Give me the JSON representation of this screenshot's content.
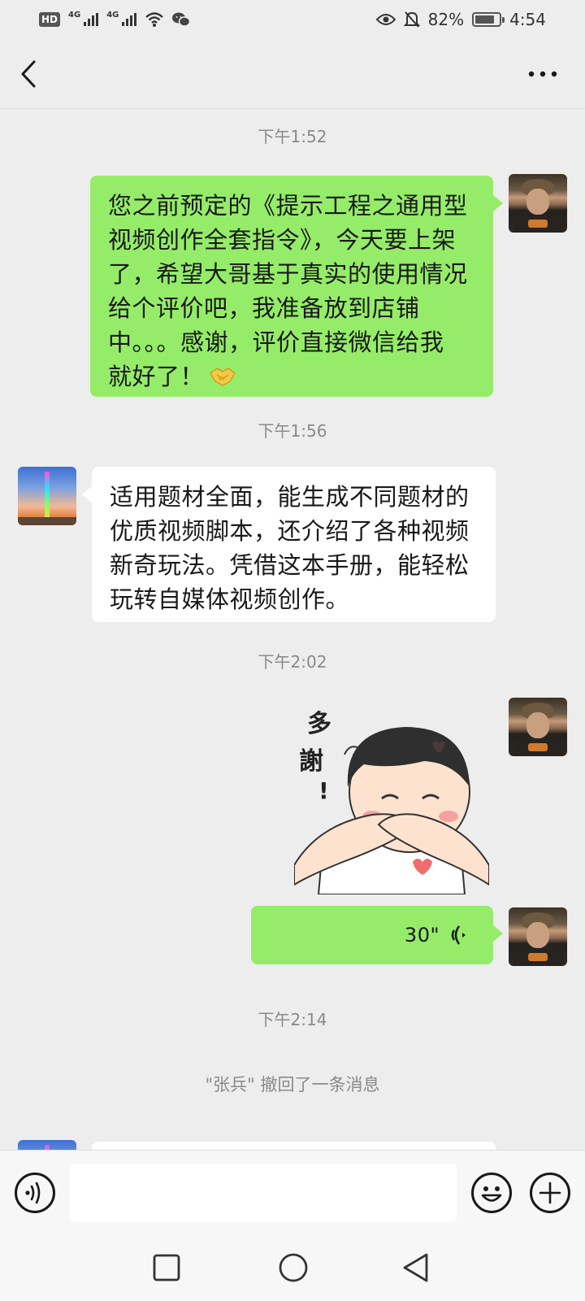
{
  "status_bar": {
    "hd": "HD",
    "net1": "4G",
    "net2": "4G",
    "battery_percent": "82%",
    "battery_level": 0.82,
    "time": "4:54",
    "icons": [
      "wifi-icon",
      "wechat-icon",
      "eye-icon",
      "bell-muted-icon"
    ]
  },
  "header": {
    "title": "",
    "back_icon": "chevron-left-icon",
    "more_icon": "more-horizontal-icon"
  },
  "messages": [
    {
      "type": "time",
      "text": "下午1:52"
    },
    {
      "type": "text",
      "sender": "me",
      "lines": [
        "您之前预定的《提示工程之通用型",
        "视频创作全套指令》，今天要上架",
        "了，希望大哥基于真实的使用情况",
        "给个评价吧，我准备放到店铺",
        "中。。。感谢，评价直接微信给我",
        "就好了！"
      ],
      "emoji": "handshake-emoji"
    },
    {
      "type": "time",
      "text": "下午1:56"
    },
    {
      "type": "text",
      "sender": "friend",
      "lines": [
        "适用题材全面，能生成不同题材的",
        "优质视频脚本，还介绍了各种视频",
        "新奇玩法。凭借这本手册，能轻松",
        "玩转自媒体视频创作。"
      ]
    },
    {
      "type": "time",
      "text": "下午2:02"
    },
    {
      "type": "sticker",
      "sender": "me",
      "caption_chars": [
        "多",
        "謝",
        "!"
      ]
    },
    {
      "type": "voice",
      "sender": "me",
      "duration": "30\""
    },
    {
      "type": "time",
      "text": "下午2:14"
    },
    {
      "type": "system",
      "text": "\"张兵\" 撤回了一条消息"
    }
  ],
  "input_bar": {
    "voice_icon": "voice-input-icon",
    "emoji_icon": "emoji-icon",
    "plus_icon": "plus-icon",
    "placeholder": ""
  },
  "nav_bar": {
    "icons": [
      "nav-recents-icon",
      "nav-home-icon",
      "nav-back-icon"
    ]
  },
  "colors": {
    "background": "#ededed",
    "bubble_me": "#95ec69",
    "bubble_friend": "#ffffff",
    "system_text": "#8a8a8a"
  }
}
